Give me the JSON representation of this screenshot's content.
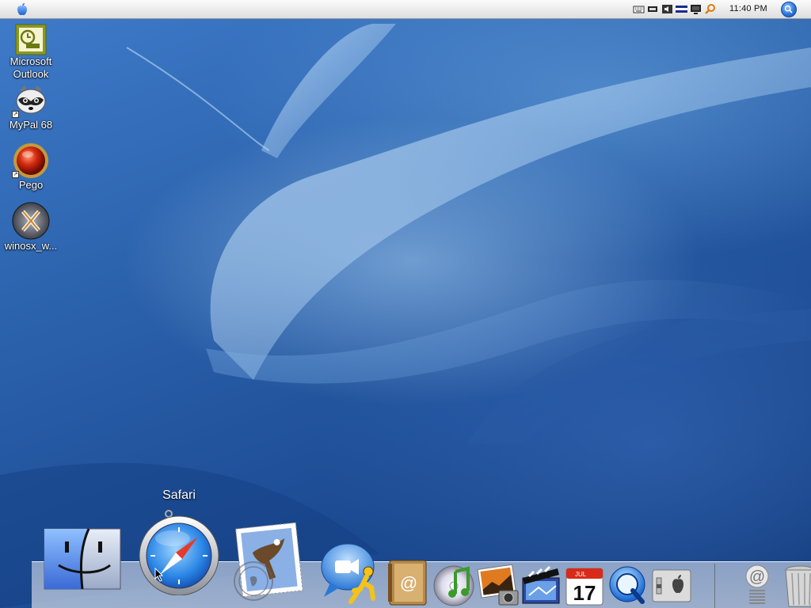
{
  "menubar": {
    "clock": "11:40 PM",
    "tray_icons": [
      "keyboard-icon",
      "battery-icon",
      "volume-icon",
      "flag-icon",
      "monitor-icon",
      "search-magnifier-icon"
    ]
  },
  "desktop_icons": [
    {
      "id": "outlook",
      "label": "Microsoft Outlook",
      "icon": "outlook-icon"
    },
    {
      "id": "mypal",
      "label": "MyPal 68",
      "icon": "raccoon-icon"
    },
    {
      "id": "pego",
      "label": "Pego",
      "icon": "red-orb-icon"
    },
    {
      "id": "winosx",
      "label": "winosx_w...",
      "icon": "winosx-icon"
    }
  ],
  "dock": {
    "tooltip": "Safari",
    "items": [
      "Finder",
      "Safari",
      "Mail",
      "iChat",
      "AIM",
      "Address Book",
      "iTunes",
      "iPhoto",
      "iMovie",
      "iCal",
      "QuickTime",
      "System Preferences",
      "Mail Drop",
      "Trash"
    ],
    "ical_month": "JUL",
    "ical_day": "17"
  },
  "colors": {
    "wallpaper": "#2c63ad",
    "menubar": "#e8e8e8"
  }
}
